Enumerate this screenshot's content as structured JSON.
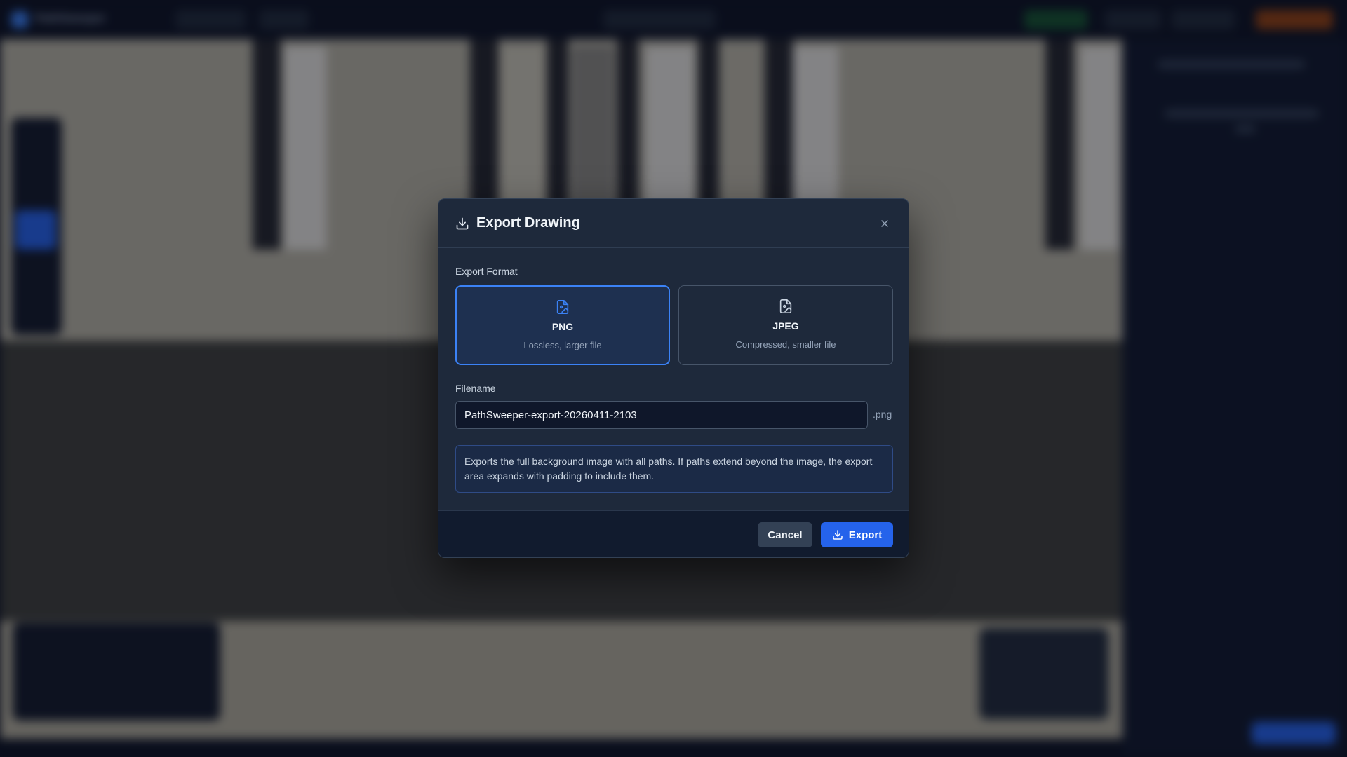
{
  "background": {
    "app_name": "PathSweeper"
  },
  "modal": {
    "title": "Export Drawing",
    "header_icon": "download-icon",
    "close_icon": "close-icon",
    "format_section_label": "Export Format",
    "formats": [
      {
        "name": "PNG",
        "description": "Lossless, larger file",
        "selected": true,
        "icon": "file-image-icon"
      },
      {
        "name": "JPEG",
        "description": "Compressed, smaller file",
        "selected": false,
        "icon": "file-image-icon"
      }
    ],
    "filename_label": "Filename",
    "filename_value": "PathSweeper-export-20260411-2103",
    "extension": ".png",
    "info_text": "Exports the full background image with all paths. If paths extend beyond the image, the export area expands with padding to include them.",
    "cancel_label": "Cancel",
    "export_label": "Export",
    "export_icon": "download-icon"
  },
  "colors": {
    "accent": "#3b82f6",
    "primary_button": "#2563eb",
    "modal_bg": "#1e293b",
    "footer_bg": "#111b2e"
  }
}
